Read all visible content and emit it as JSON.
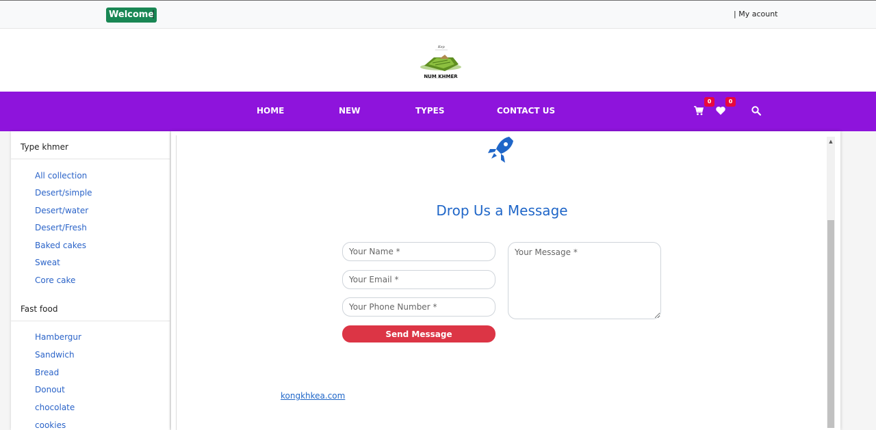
{
  "topbar": {
    "welcome": "Welcome",
    "separator": "|",
    "account": "| My acount"
  },
  "brand": {
    "name": "NUM KHMER"
  },
  "nav": {
    "items": [
      "HOME",
      "NEW",
      "TYPES",
      "CONTACT US"
    ],
    "cart_count": "0",
    "wishlist_count": "0"
  },
  "sidebar": {
    "sections": [
      {
        "heading": "Type khmer",
        "links": [
          "All collection",
          "Desert/simple",
          "Desert/water",
          "Desert/Fresh",
          "Baked cakes",
          "Sweat",
          "Core cake"
        ]
      },
      {
        "heading": "Fast food",
        "links": [
          "Hambergur",
          "Sandwich",
          "Bread",
          "Donout",
          "chocolate",
          "cookies"
        ]
      }
    ]
  },
  "contact": {
    "title": "Drop Us a Message",
    "name_placeholder": "Your Name *",
    "email_placeholder": "Your Email *",
    "phone_placeholder": "Your Phone Number *",
    "message_placeholder": "Your Message *",
    "send_label": "Send Message",
    "site_link": "kongkhkea.com"
  },
  "colors": {
    "nav": "#8e14dc",
    "welcome": "#198754",
    "send": "#dc3545",
    "accent": "#1f66c8",
    "badge": "#e8083e"
  }
}
